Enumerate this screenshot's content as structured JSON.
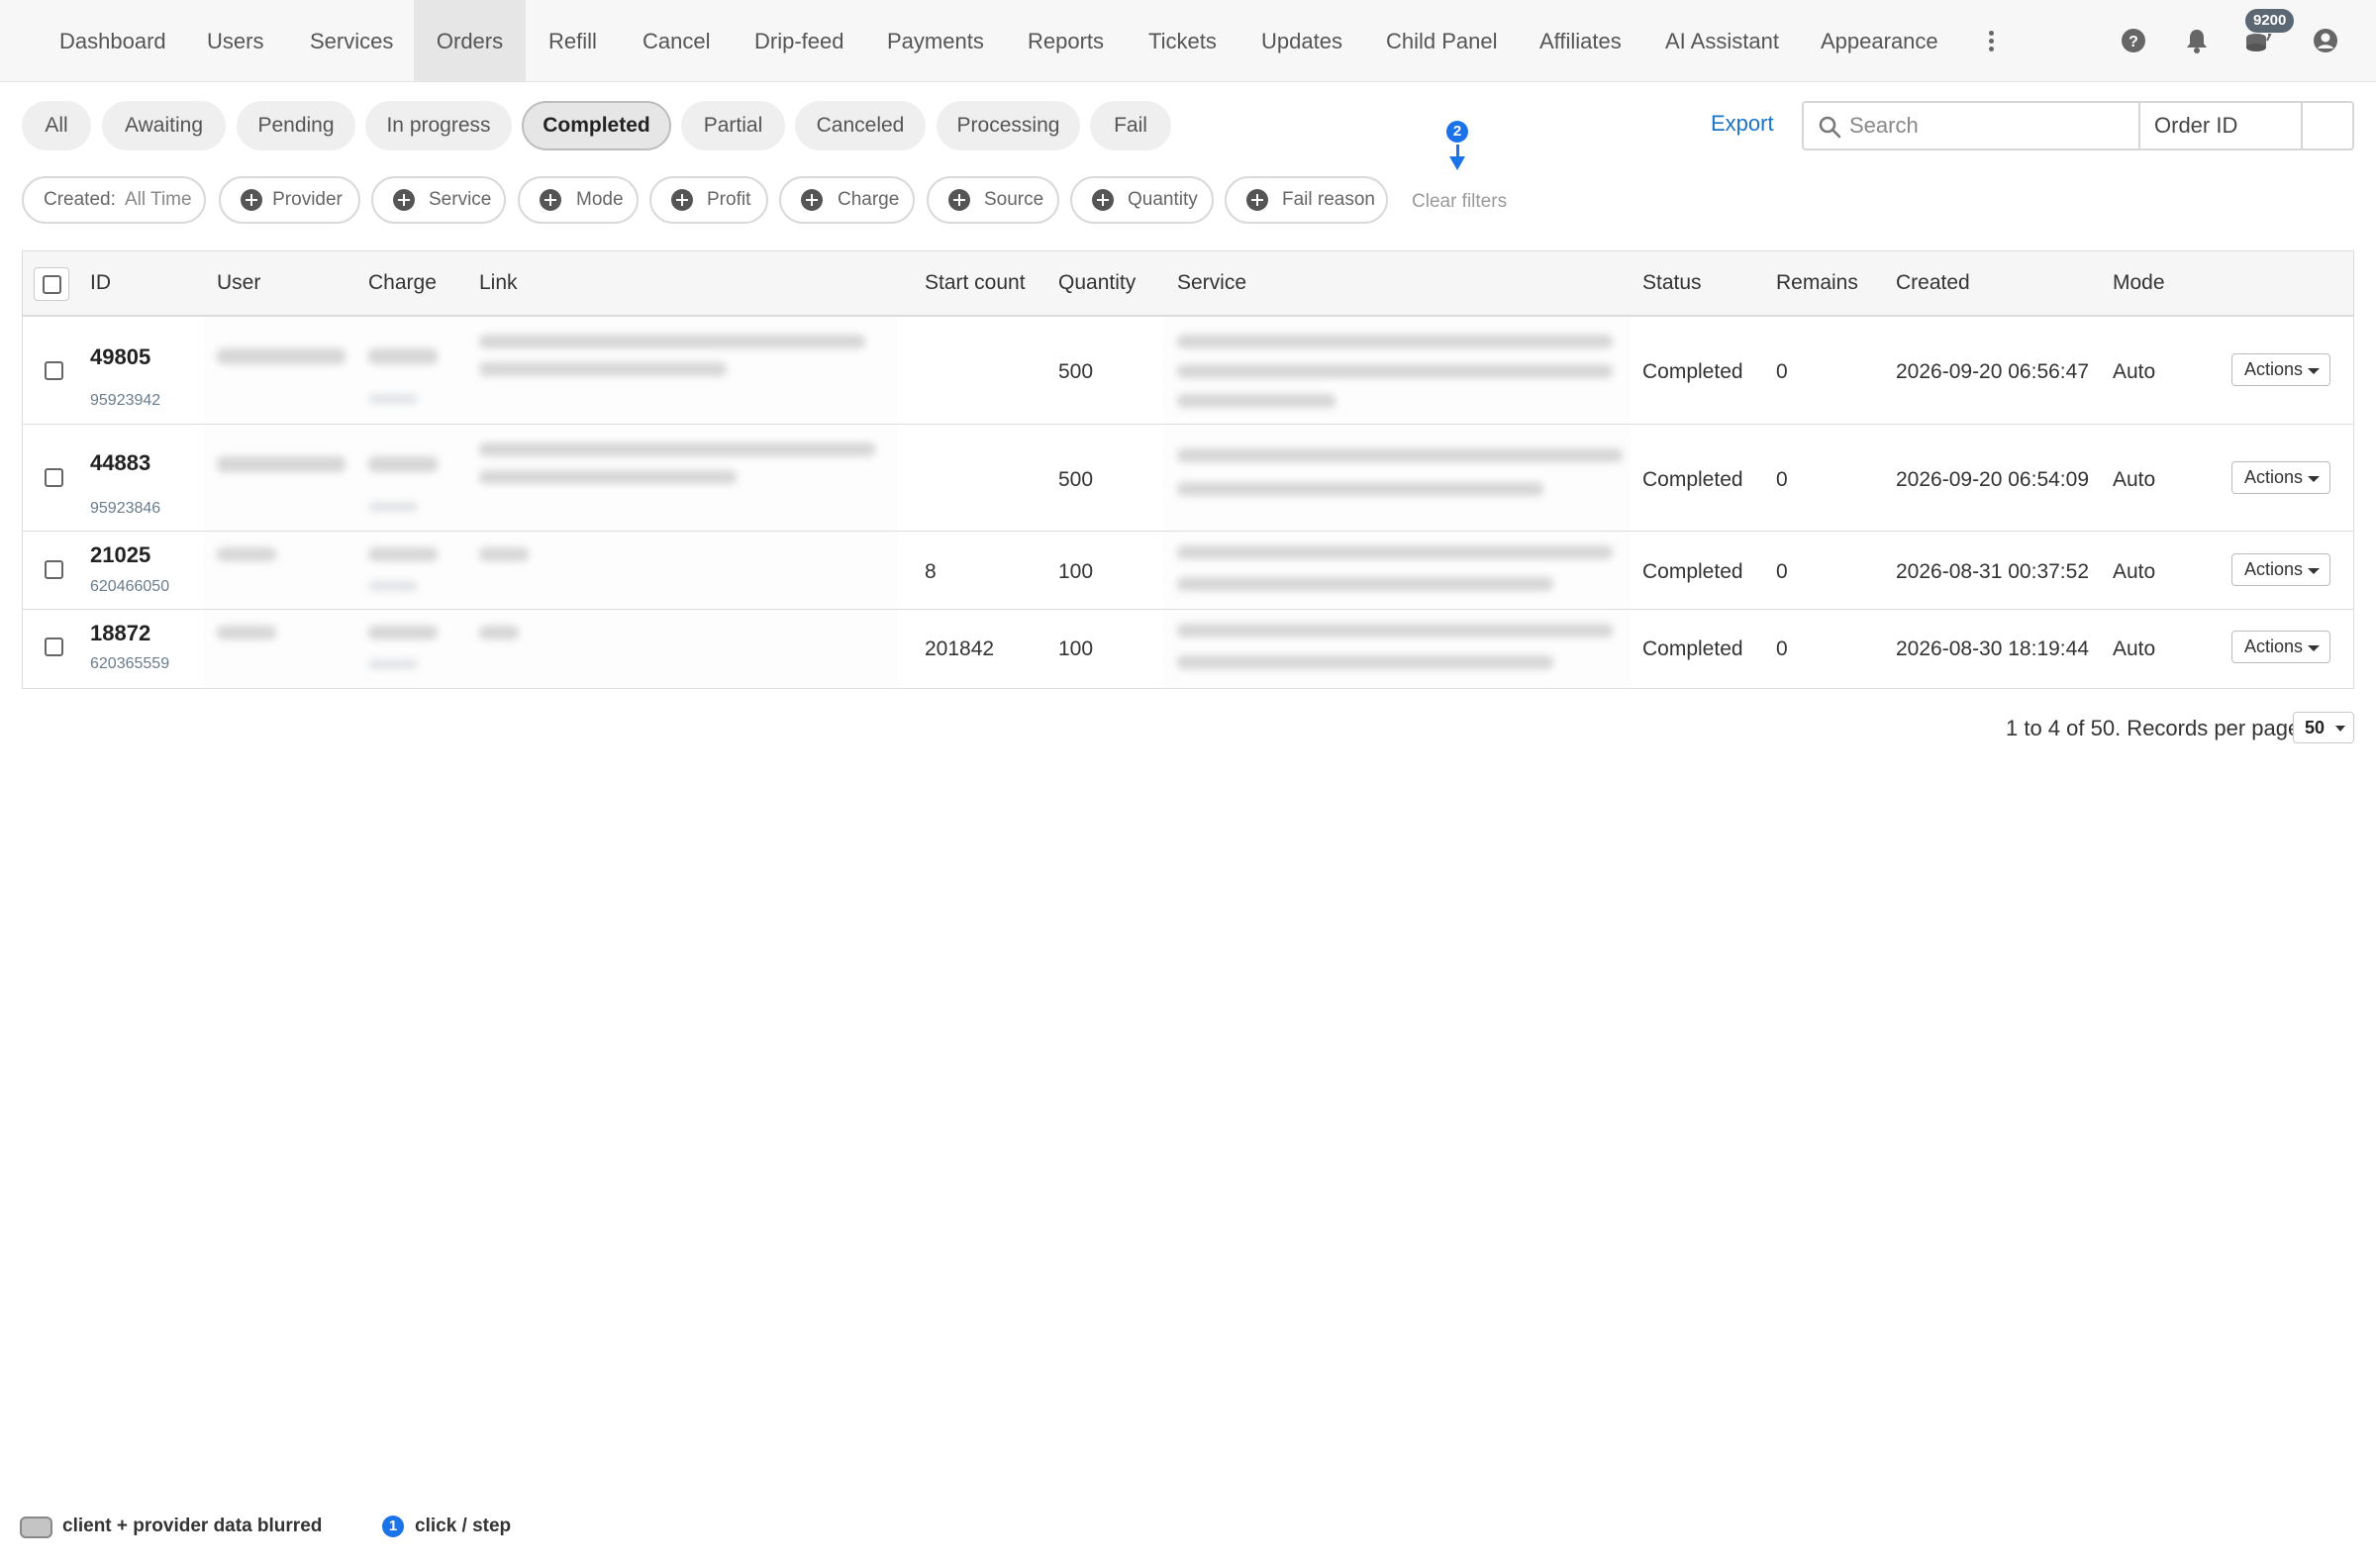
{
  "nav": {
    "items": [
      {
        "label": "Dashboard"
      },
      {
        "label": "Users"
      },
      {
        "label": "Services"
      },
      {
        "label": "Orders"
      },
      {
        "label": "Refill"
      },
      {
        "label": "Cancel"
      },
      {
        "label": "Drip-feed"
      },
      {
        "label": "Payments"
      },
      {
        "label": "Reports"
      },
      {
        "label": "Tickets"
      },
      {
        "label": "Updates"
      },
      {
        "label": "Child Panel"
      },
      {
        "label": "Affiliates"
      },
      {
        "label": "AI Assistant"
      },
      {
        "label": "Appearance"
      }
    ],
    "active": "Orders",
    "more_icon": "vertical-dots-icon",
    "right_icons": [
      "help-icon",
      "bell-icon",
      "coins-icon",
      "account-icon"
    ],
    "balance_badge": "9200"
  },
  "status_tabs": [
    {
      "label": "All"
    },
    {
      "label": "Awaiting"
    },
    {
      "label": "Pending"
    },
    {
      "label": "In progress"
    },
    {
      "label": "Completed"
    },
    {
      "label": "Partial"
    },
    {
      "label": "Canceled"
    },
    {
      "label": "Processing"
    },
    {
      "label": "Fail"
    }
  ],
  "active_status": "Completed",
  "toolbar": {
    "export_label": "Export",
    "search_placeholder": "Search",
    "search_type": "Order ID"
  },
  "filters": {
    "created_label": "Created:",
    "created_value": "All Time",
    "items": [
      {
        "label": "Provider"
      },
      {
        "label": "Service"
      },
      {
        "label": "Mode"
      },
      {
        "label": "Profit"
      },
      {
        "label": "Charge"
      },
      {
        "label": "Source"
      },
      {
        "label": "Quantity"
      },
      {
        "label": "Fail reason"
      }
    ],
    "clear_label": "Clear filters",
    "step_marker": "2"
  },
  "table": {
    "columns": [
      "ID",
      "User",
      "Charge",
      "Link",
      "Start count",
      "Quantity",
      "Service",
      "Status",
      "Remains",
      "Created",
      "Mode"
    ],
    "rows": [
      {
        "id": "49805",
        "external_id": "95923942",
        "start_count": "",
        "quantity": "500",
        "status": "Completed",
        "remains": "0",
        "created": "2026-09-20 06:56:47",
        "mode": "Auto",
        "actions": "Actions"
      },
      {
        "id": "44883",
        "external_id": "95923846",
        "start_count": "",
        "quantity": "500",
        "status": "Completed",
        "remains": "0",
        "created": "2026-09-20 06:54:09",
        "mode": "Auto",
        "actions": "Actions"
      },
      {
        "id": "21025",
        "external_id": "620466050",
        "start_count": "8",
        "quantity": "100",
        "status": "Completed",
        "remains": "0",
        "created": "2026-08-31 00:37:52",
        "mode": "Auto",
        "actions": "Actions"
      },
      {
        "id": "18872",
        "external_id": "620365559",
        "start_count": "201842",
        "quantity": "100",
        "status": "Completed",
        "remains": "0",
        "created": "2026-08-30 18:19:44",
        "mode": "Auto",
        "actions": "Actions"
      }
    ]
  },
  "pagination": {
    "summary": "1 to 4 of 50. Records per page",
    "per_page": "50"
  },
  "legend": {
    "blur_label": "client + provider data blurred",
    "step_badge": "1",
    "step_label": "click / step"
  },
  "colors": {
    "accent": "#1a73c7",
    "step_marker": "#1a73e8",
    "badge": "#5b6773"
  }
}
